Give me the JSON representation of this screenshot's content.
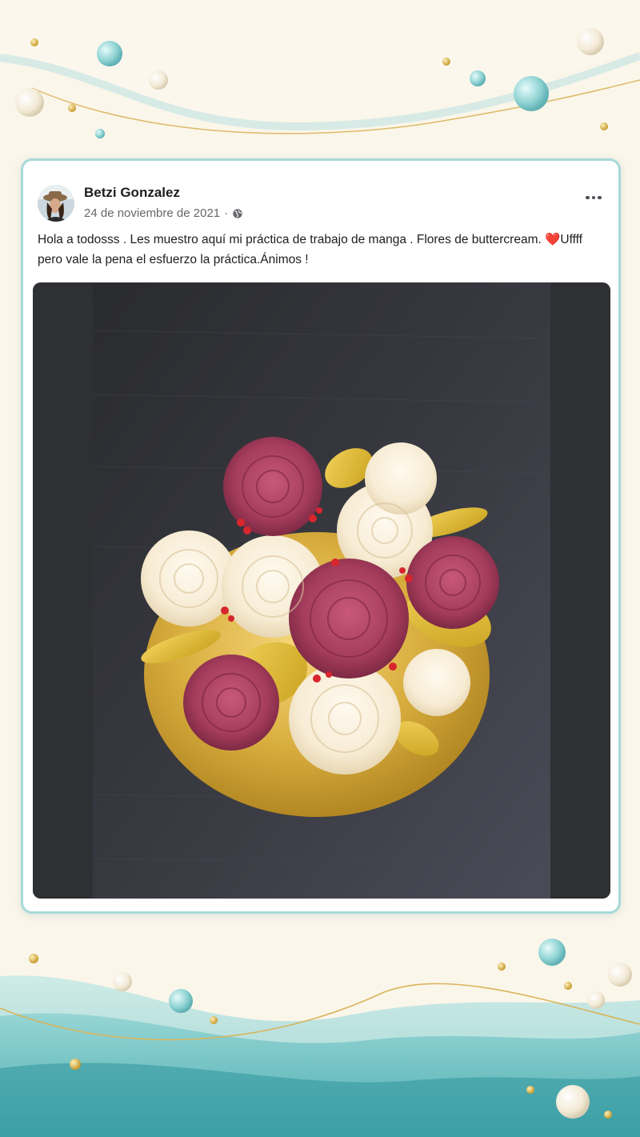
{
  "post": {
    "author": "Betzi Gonzalez",
    "date": "24 de noviembre de 2021",
    "separator": "·",
    "privacy_icon": "globe-icon",
    "more_icon": "more-options-icon",
    "text_main": "Hola a todosss .  Les muestro aquí mi práctica de trabajo de manga . Flores de buttercream. ",
    "text_emoji": "❤️",
    "text_end": "Uffff pero vale la pena el esfuerzo la práctica.Ánimos !",
    "photo_description": "buttercream-flower-cupcake-photo"
  },
  "colors": {
    "card_border": "#a8d8d9",
    "background": "#fbf6ea",
    "text": "#1c1e21",
    "meta_text": "#65676b"
  }
}
